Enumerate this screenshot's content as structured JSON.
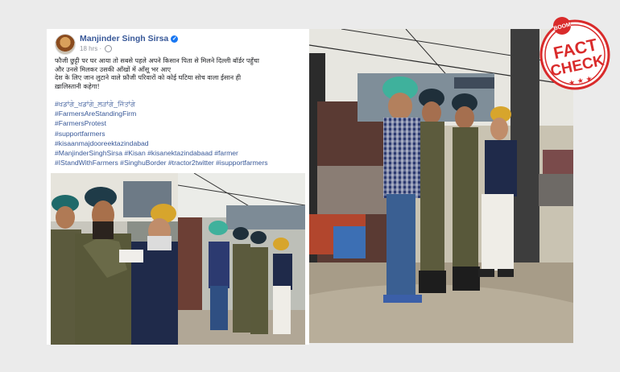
{
  "post": {
    "author": "Manjinder Singh Sirsa",
    "time": "18 hrs",
    "text_lines": [
      "फौजी छुट्टी पर घर आया तो सबसे पहले अपने किसान पिता से मिलने दिल्ली बॉर्डर पहुँचा",
      "और उनसे मिलकर उसकी आँखों में आँसू भर आए",
      "देश के लिए जान लुटाने वाले फ़ौजी परिवारों को कोई घटिया सोच वाला ईसान ही",
      "ख़ालिस्तानी कहेगा!"
    ],
    "hashtags": [
      "#ਖਡਾਂਗੇ_ਖਡਾਂਗੇ_ਲੜਾਂਗੇ_ਜਿੱਤਾਂਗੇ",
      "#FarmersAreStandingFirm",
      "#FarmersProtest",
      "#supportfarmers",
      "#kisaanmajdooreektazindabad",
      "#ManjinderSinghSirsa #Kisan #kisanektazindabaad #farmer",
      "#IStandWithFarmers #SinghuBorder #tractor2twitter #isupportfarmers"
    ]
  },
  "stamp": {
    "top_text": "BOOM",
    "line1": "FACT",
    "line2": "CHECK",
    "colors": {
      "red": "#d92b2b",
      "white": "#ffffff"
    }
  },
  "colors": {
    "link": "#385898",
    "background": "#ebebeb"
  }
}
